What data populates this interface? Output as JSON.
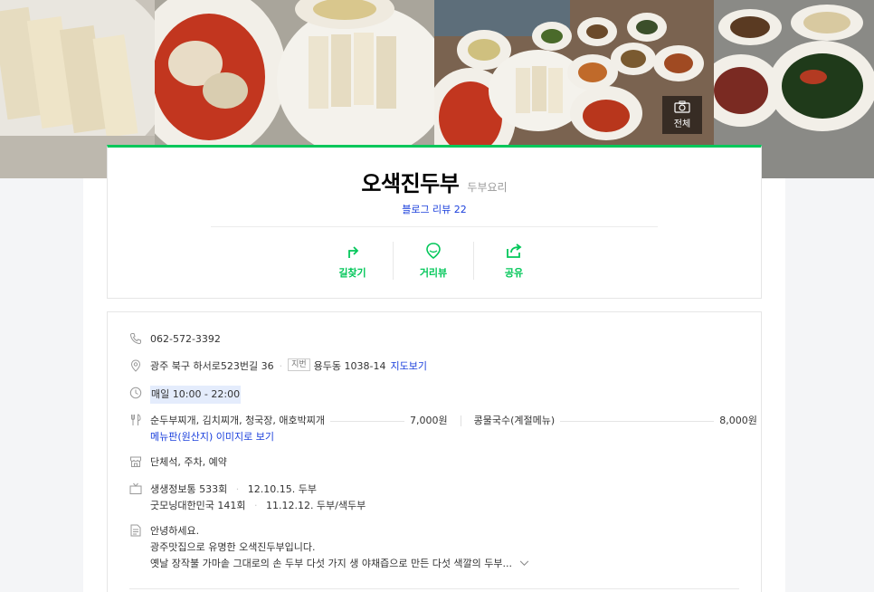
{
  "header": {
    "all_photos_label": "전체"
  },
  "place": {
    "name": "오색진두부",
    "category": "두부요리",
    "blog_review": "블로그 리뷰 22"
  },
  "actions": [
    {
      "label": "길찾기",
      "icon": "directions-icon"
    },
    {
      "label": "거리뷰",
      "icon": "street-view-icon"
    },
    {
      "label": "공유",
      "icon": "share-icon"
    }
  ],
  "info": {
    "phone": "062-572-3392",
    "address": {
      "road": "광주 북구 하서로523번길 36",
      "jibun_badge": "지번",
      "jibun": "용두동 1038-14",
      "map_link": "지도보기"
    },
    "hours": "매일 10:00 - 22:00",
    "menu": [
      {
        "name": "순두부찌개, 김치찌개, 청국장, 애호박찌개",
        "price": "7,000원"
      },
      {
        "name": "콩물국수(계절메뉴)",
        "price": "8,000원"
      }
    ],
    "menu_image_link": "메뉴판(원산지) 이미지로 보기",
    "facilities": "단체석, 주차, 예약",
    "tv": [
      {
        "program": "생생정보통 533회",
        "detail": "12.10.15. 두부"
      },
      {
        "program": "굿모닝대한민국 141회",
        "detail": "11.12.12. 두부/색두부"
      }
    ],
    "description": [
      "안녕하세요.",
      "광주맛집으로 유명한 오색진두부입니다.",
      "옛날 장작불 가마솥 그대로의 손 두부 다섯 가지 생 야채즙으로 만든 다섯 색깔의 두부..."
    ]
  },
  "colors": {
    "accent": "#03c75a",
    "link": "#1a3fdc"
  }
}
